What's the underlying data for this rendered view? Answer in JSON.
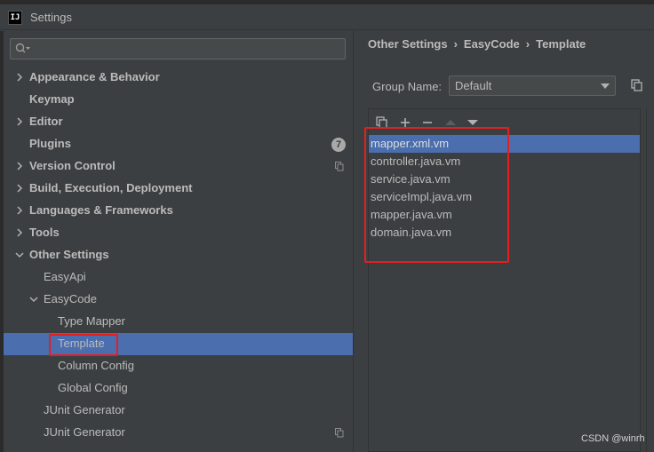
{
  "window": {
    "title": "Settings",
    "app_icon": "IJ"
  },
  "search": {
    "placeholder": "",
    "value": ""
  },
  "tree": [
    {
      "label": "Appearance & Behavior",
      "bold": true,
      "chevron": "right"
    },
    {
      "label": "Keymap",
      "bold": true,
      "chevron": "none"
    },
    {
      "label": "Editor",
      "bold": true,
      "chevron": "right"
    },
    {
      "label": "Plugins",
      "bold": true,
      "chevron": "none",
      "badge": "7"
    },
    {
      "label": "Version Control",
      "bold": true,
      "chevron": "right",
      "copy_icon": true
    },
    {
      "label": "Build, Execution, Deployment",
      "bold": true,
      "chevron": "right"
    },
    {
      "label": "Languages & Frameworks",
      "bold": true,
      "chevron": "right"
    },
    {
      "label": "Tools",
      "bold": true,
      "chevron": "right"
    },
    {
      "label": "Other Settings",
      "bold": true,
      "chevron": "down"
    },
    {
      "label": "EasyApi",
      "bold": false,
      "chevron": "none"
    },
    {
      "label": "EasyCode",
      "bold": false,
      "chevron": "down"
    },
    {
      "label": "Type Mapper",
      "bold": false,
      "chevron": "none"
    },
    {
      "label": "Template",
      "bold": false,
      "chevron": "none",
      "selected": true
    },
    {
      "label": "Column Config",
      "bold": false,
      "chevron": "none"
    },
    {
      "label": "Global Config",
      "bold": false,
      "chevron": "none"
    },
    {
      "label": "JUnit Generator",
      "bold": false,
      "chevron": "none"
    },
    {
      "label": "JUnit Generator",
      "bold": false,
      "chevron": "none",
      "copy_icon": true
    }
  ],
  "breadcrumb": [
    "Other Settings",
    "EasyCode",
    "Template"
  ],
  "group": {
    "label": "Group Name:",
    "selected": "Default"
  },
  "toolbar": [
    "copy-icon",
    "plus-icon",
    "minus-icon",
    "arrow-up-icon",
    "arrow-down-icon"
  ],
  "templates": [
    {
      "name": "mapper.xml.vm",
      "selected": true
    },
    {
      "name": "controller.java.vm"
    },
    {
      "name": "service.java.vm"
    },
    {
      "name": "serviceImpl.java.vm"
    },
    {
      "name": "mapper.java.vm"
    },
    {
      "name": "domain.java.vm"
    }
  ],
  "colors": {
    "background": "#3c3f41",
    "selection": "#4b6eaf",
    "highlight": "#e51e1e",
    "text": "#bbbbbb"
  },
  "watermark": "CSDN @winrh"
}
